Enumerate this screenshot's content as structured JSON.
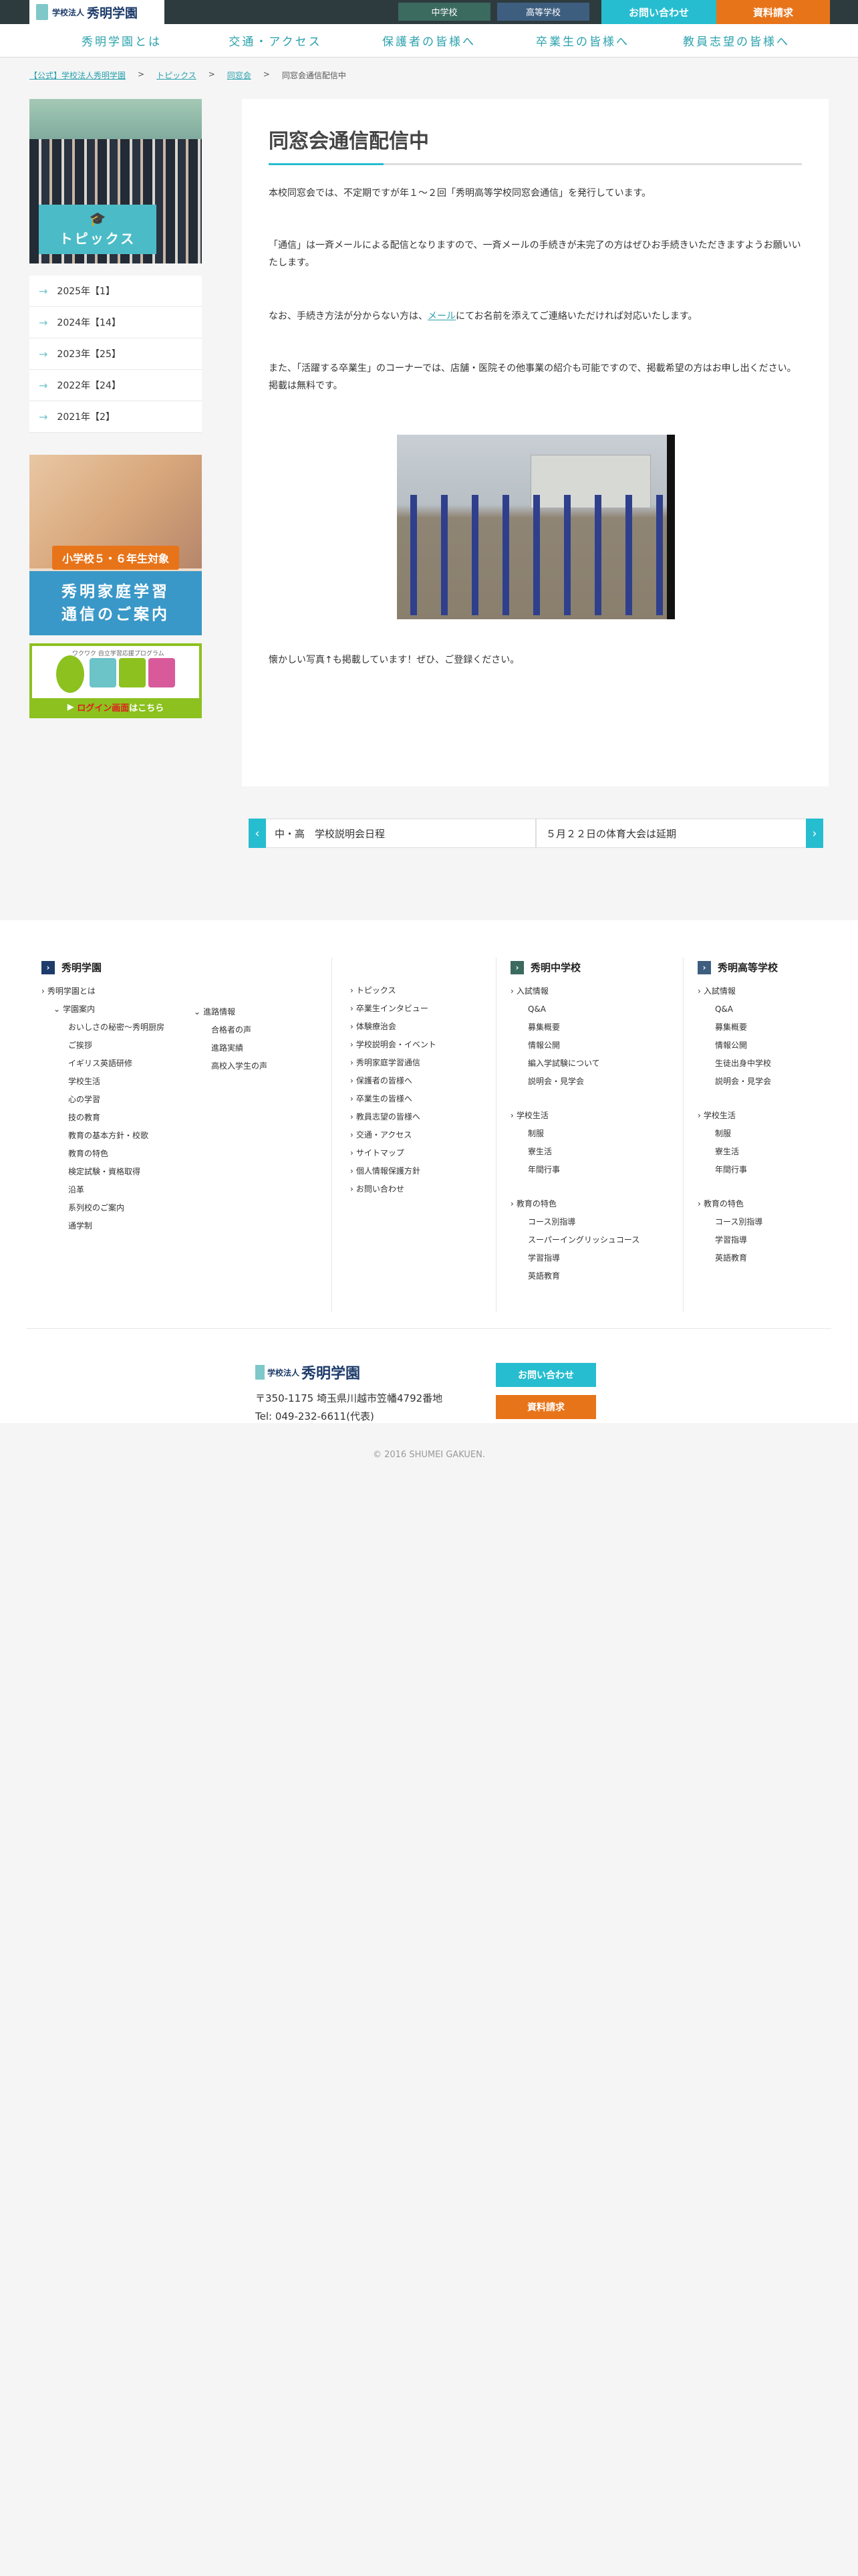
{
  "header": {
    "logo_small": "学校法人",
    "logo_big": "秀明学園",
    "jh_label": "中学校",
    "hs_label": "高等学校",
    "contact_label": "お問い合わせ",
    "doc_label": "資料請求"
  },
  "nav": [
    "秀明学園とは",
    "交通・アクセス",
    "保護者の皆様へ",
    "卒業生の皆様へ",
    "教員志望の皆様へ"
  ],
  "breadcrumb": [
    "【公式】学校法人秀明学園",
    "トピックス",
    "同窓会",
    "同窓会通信配信中"
  ],
  "sidebar": {
    "topics_label": "トピックス",
    "years": [
      "2025年【1】",
      "2024年【14】",
      "2023年【25】",
      "2022年【24】",
      "2021年【2】"
    ],
    "banner1_ribbon": "小学校５・６年生対象",
    "banner1_line1": "秀明家庭学習",
    "banner1_line2": "通信のご案内",
    "banner2_tag": "ワクワク 自立学習応援プログラム",
    "banner2_login": "ログイン画面",
    "banner2_suffix": "はこちら"
  },
  "article": {
    "title": "同窓会通信配信中",
    "p1": "本校同窓会では、不定期ですが年１～２回「秀明高等学校同窓会通信」を発行しています。",
    "p2": "「通信」は一斉メールによる配信となりますので、一斉メールの手続きが未完了の方はぜひお手続きいただきますようお願いいたします。",
    "p3_before": "なお、手続き方法が分からない方は、",
    "p3_link": "メール",
    "p3_after": "にてお名前を添えてご連絡いただければ対応いたします。",
    "p4": "また、「活躍する卒業生」のコーナーでは、店舗・医院その他事業の紹介も可能ですので、掲載希望の方はお申し出ください。掲載は無料です。",
    "p5": "懐かしい写真↑も掲載しています！ぜひ、ご登録ください。"
  },
  "pager": {
    "prev": "中・高　学校説明会日程",
    "next": "５月２２日の体育大会は延期"
  },
  "footer": {
    "col1_title": "秀明学園",
    "col1_about": "秀明学園とは",
    "col1_guide": "学園案内",
    "col1_guide_items": [
      "おいしさの秘密～秀明厨房",
      "ご挨拶",
      "イギリス英語研修",
      "学校生活",
      "心の学習",
      "技の教育",
      "教育の基本方針・校歌",
      "教育の特色",
      "検定試験・資格取得",
      "沿革",
      "系列校のご案内",
      "通学制"
    ],
    "col1b_head": "進路情報",
    "col1b_items": [
      "合格者の声",
      "進路実績",
      "高校入学生の声"
    ],
    "col2_items": [
      "トピックス",
      "卒業生インタビュー",
      "体験療治会",
      "学校説明会・イベント",
      "秀明家庭学習通信",
      "保護者の皆様へ",
      "卒業生の皆様へ",
      "教員志望の皆様へ",
      "交通・アクセス",
      "サイトマップ",
      "個人情報保護方針",
      "お問い合わせ"
    ],
    "jh_title": "秀明中学校",
    "jh_nyushi": "入試情報",
    "jh_nyushi_items": [
      "Q&A",
      "募集概要",
      "情報公開",
      "編入学試験について",
      "説明会・見学会"
    ],
    "jh_life": "学校生活",
    "jh_life_items": [
      "制服",
      "寮生活",
      "年間行事"
    ],
    "jh_feat": "教育の特色",
    "jh_feat_items": [
      "コース別指導",
      "スーパーイングリッシュコース",
      "学習指導",
      "英語教育"
    ],
    "hs_title": "秀明高等学校",
    "hs_nyushi": "入試情報",
    "hs_nyushi_items": [
      "Q&A",
      "募集概要",
      "情報公開",
      "生徒出身中学校",
      "説明会・見学会"
    ],
    "hs_life": "学校生活",
    "hs_life_items": [
      "制服",
      "寮生活",
      "年間行事"
    ],
    "hs_feat": "教育の特色",
    "hs_feat_items": [
      "コース別指導",
      "学習指導",
      "英語教育"
    ],
    "logo_small": "学校法人",
    "logo_big": "秀明学園",
    "address": "〒350-1175 埼玉県川越市笠幡4792番地",
    "tel": "Tel: 049-232-6611(代表)",
    "contact_label": "お問い合わせ",
    "doc_label": "資料請求",
    "copyright": "© 2016 SHUMEI GAKUEN."
  }
}
